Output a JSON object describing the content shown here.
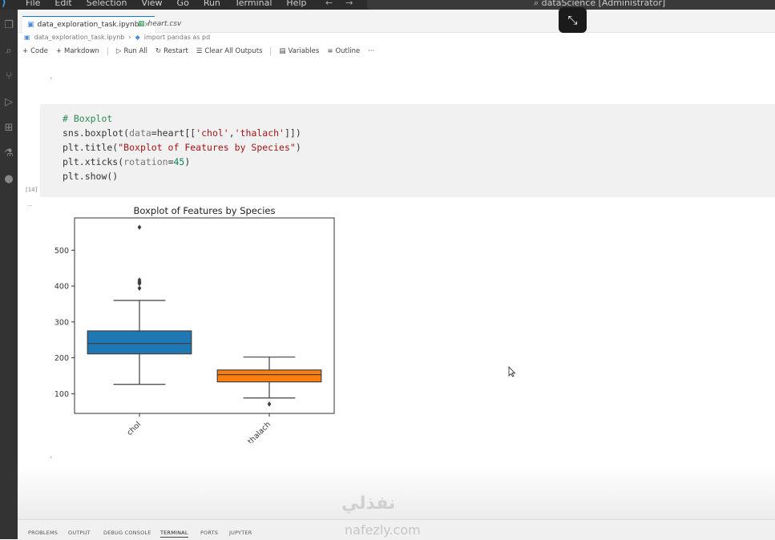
{
  "menubar": {
    "items": [
      "File",
      "Edit",
      "Selection",
      "View",
      "Go",
      "Run",
      "Terminal",
      "Help"
    ],
    "command_center": "dataScience [Administrator]"
  },
  "tabs": [
    {
      "label": "data_exploration_task.ipynb",
      "icon": "notebook-icon"
    },
    {
      "label": "heart.csv",
      "icon": "table-icon"
    }
  ],
  "breadcrumb": [
    "data_exploration_task.ipynb",
    "import pandas as pd"
  ],
  "toolbar": {
    "code": "Code",
    "markdown": "Markdown",
    "run_all": "Run All",
    "restart": "Restart",
    "clear_all": "Clear All Outputs",
    "variables": "Variables",
    "outline": "Outline",
    "more": "···"
  },
  "cell": {
    "exec_count": "[14]",
    "lines": {
      "l1": "# Boxplot",
      "l2a": "sns.boxplot(",
      "l2b": "data",
      "l2c": "=heart[[",
      "l2d": "'chol'",
      "l2e": ",",
      "l2f": "'thalach'",
      "l2g": "]])",
      "l3a": "plt.title(",
      "l3b": "\"Boxplot of Features by Species\"",
      "l3c": ")",
      "l4a": "plt.xticks(",
      "l4b": "rotation",
      "l4c": "=",
      "l4d": "45",
      "l4e": ")",
      "l5": "plt.show()"
    }
  },
  "panel_tabs": [
    "PROBLEMS",
    "OUTPUT",
    "DEBUG CONSOLE",
    "TERMINAL",
    "PORTS",
    "JUPYTER"
  ],
  "watermark": {
    "arabic": "نفذلي",
    "latin": "nafezly.com"
  },
  "colors": {
    "chol": "#1f77b4",
    "thalach": "#ff7f0e",
    "accent": "#0b7ad1"
  },
  "chart_data": {
    "type": "box",
    "title": "Boxplot of Features by Species",
    "categories": [
      "chol",
      "thalach"
    ],
    "yticks": [
      100,
      200,
      300,
      400,
      500
    ],
    "ylim": [
      45,
      590
    ],
    "xlabel_rotation": 45,
    "boxes": [
      {
        "name": "chol",
        "whisker_low": 126,
        "q1": 211,
        "median": 240,
        "q3": 275,
        "whisker_high": 360,
        "outliers": [
          394,
          407,
          409,
          412,
          417,
          564
        ]
      },
      {
        "name": "thalach",
        "whisker_low": 88,
        "q1": 133,
        "median": 153,
        "q3": 166,
        "whisker_high": 202,
        "outliers": [
          71
        ]
      }
    ]
  }
}
